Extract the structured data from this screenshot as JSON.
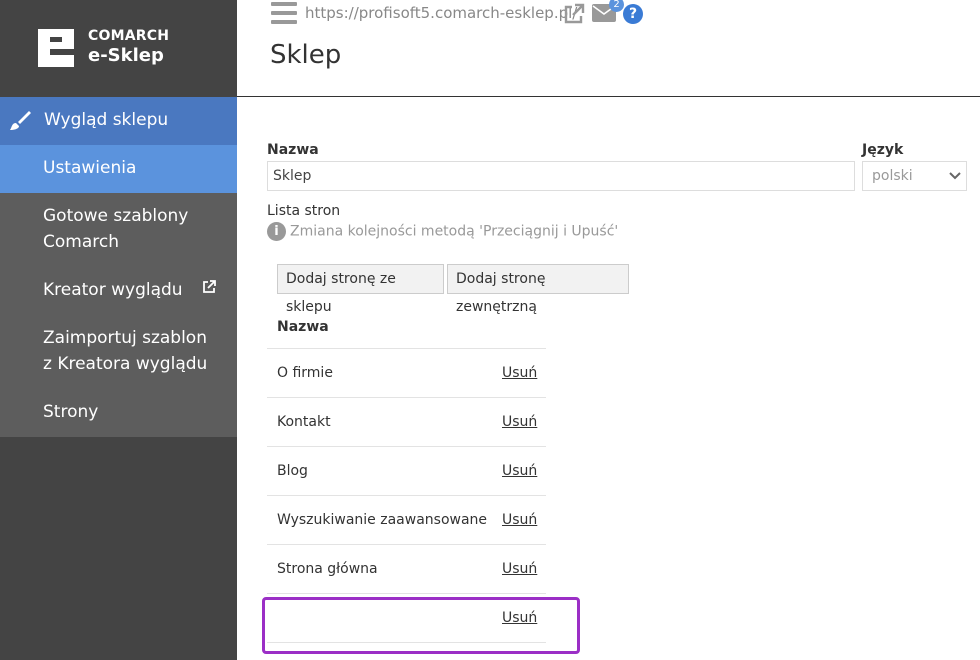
{
  "brand": {
    "line1": "COMARCH",
    "line2": "e-Sklep"
  },
  "sidebar": {
    "section": "Wygląd sklepu",
    "items": [
      {
        "label": "Ustawienia"
      },
      {
        "label": "Gotowe szablony Comarch"
      },
      {
        "label": "Kreator wyglądu"
      },
      {
        "label": "Zaimportuj szablon z Kreatora wyglądu"
      },
      {
        "label": "Strony"
      }
    ]
  },
  "header": {
    "url": "https://profisoft5.comarch-esklep.pl/",
    "mail_badge": "2",
    "help": "?",
    "title": "Sklep"
  },
  "form": {
    "name_label": "Nazwa",
    "name_value": "Sklep",
    "lang_label": "Język",
    "lang_value": "polski",
    "pages_label": "Lista stron",
    "info_icon": "i",
    "info_text": "Zmiana kolejności metodą 'Przeciągnij i Upuść'",
    "btn_add_store": "Dodaj stronę ze sklepu",
    "btn_add_external": "Dodaj stronę zewnętrzną"
  },
  "table": {
    "header": "Nazwa",
    "rows": [
      {
        "name": "O firmie",
        "action": "Usuń"
      },
      {
        "name": "Kontakt",
        "action": "Usuń"
      },
      {
        "name": "Blog",
        "action": "Usuń"
      },
      {
        "name": "Wyszukiwanie zaawansowane",
        "action": "Usuń"
      },
      {
        "name": "Strona główna",
        "action": "Usuń"
      },
      {
        "name": "",
        "action": "Usuń"
      }
    ]
  },
  "colors": {
    "sidebar_bg": "#444444",
    "active_section": "#4a78c0",
    "active_item": "#5b93dd",
    "highlight": "#9b2fc6"
  }
}
